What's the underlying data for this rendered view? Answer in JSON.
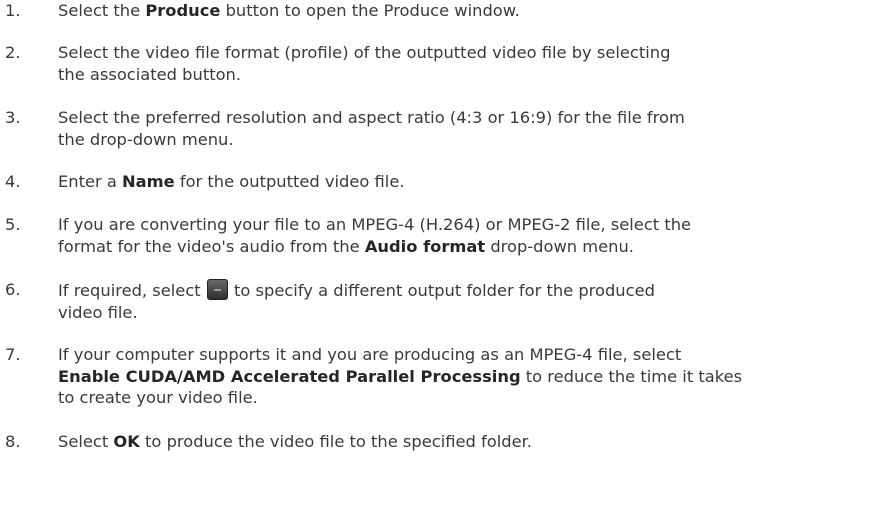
{
  "steps": [
    {
      "num": "1.",
      "lines": [
        {
          "pre": "Select the ",
          "bold": "Produce",
          "post": " button to open the Produce window."
        }
      ]
    },
    {
      "num": "2.",
      "lines": [
        {
          "pre": "Select the video file format (profile) of the outputted video file by selecting"
        },
        {
          "pre": "the associated button."
        }
      ]
    },
    {
      "num": "3.",
      "lines": [
        {
          "pre": "Select the preferred resolution and aspect ratio (4:3 or 16:9) for the file from"
        },
        {
          "pre": "the drop-down menu."
        }
      ]
    },
    {
      "num": "4.",
      "lines": [
        {
          "pre": "Enter a ",
          "bold": "Name",
          "post": " for the outputted video file."
        }
      ]
    },
    {
      "num": "5.",
      "lines": [
        {
          "pre": "If you are converting your file to an MPEG-4 (H.264) or MPEG-2 file, select the"
        },
        {
          "pre": "format for the video's audio from the ",
          "bold": "Audio format",
          "post": " drop-down menu."
        }
      ]
    },
    {
      "num": "6.",
      "lines": [
        {
          "pre": "If required, select ",
          "icon": "folder-browse-icon",
          "post": " to specify a different output folder for the produced"
        },
        {
          "pre": "video file."
        }
      ]
    },
    {
      "num": "7.",
      "lines": [
        {
          "pre": "If your computer supports it and you are producing as an MPEG-4 file, select"
        },
        {
          "bold": "Enable CUDA/AMD Accelerated Parallel Processing",
          "post": " to reduce the time it takes"
        },
        {
          "pre": "to create your video file."
        }
      ]
    },
    {
      "num": "8.",
      "lines": [
        {
          "pre": "Select ",
          "bold": "OK",
          "post": " to produce the video file to the specified folder."
        }
      ]
    }
  ]
}
